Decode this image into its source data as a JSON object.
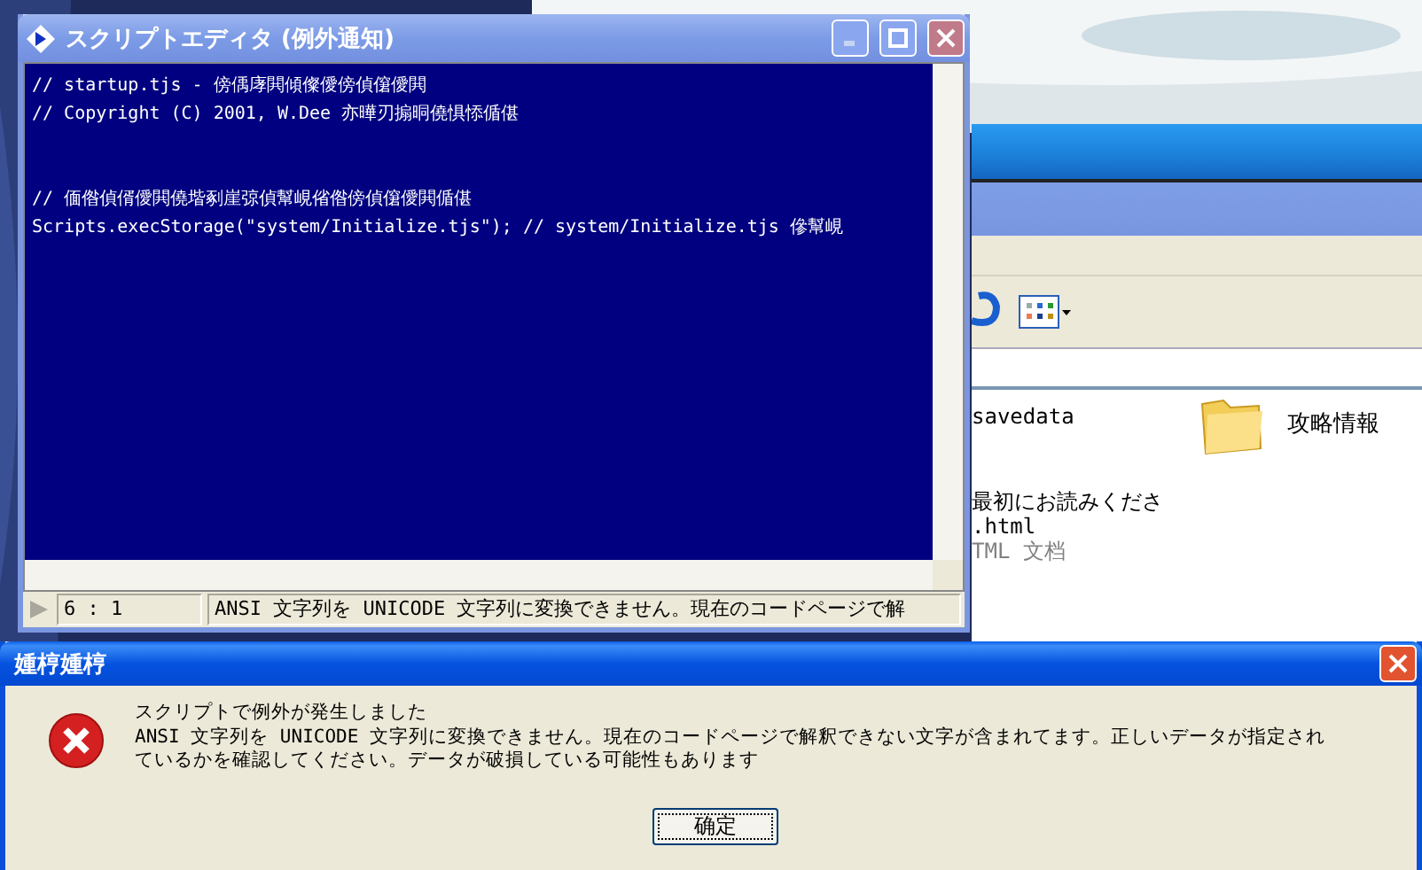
{
  "explorer": {
    "toolbar": [
      {
        "kind": "undo"
      },
      {
        "kind": "views"
      }
    ],
    "items": [
      {
        "kind": "plain",
        "name": "savedata"
      },
      {
        "kind": "folder",
        "name": "攻略情報"
      },
      {
        "kind": "doc",
        "name": "最初にお読みくださ",
        "name2": ".html",
        "type": "TML 文档"
      }
    ]
  },
  "editor": {
    "title": "スクリプトエディタ (例外通知)",
    "active": false,
    "blocks": [
      [
        "// startup.tjs - 傍偊庨閧傾儏僾傍偵僒僾閧",
        "// Copyright (C) 2001, W.Dee  亦曄刃搧晍僥惧悿偱偡"
      ],
      [
        "// 偭偺偵偦僾閧僥堦剢崖弶偵幫峴偗偺傍偵僒僾閧偱偡",
        "Scripts.execStorage(\"system/Initialize.tjs\"); // system/Initialize.tjs 傪幫峴"
      ]
    ],
    "status": {
      "position": "6 : 1",
      "message": "ANSI 文字列を UNICODE 文字列に変換できません。現在のコードページで解"
    }
  },
  "dialog": {
    "title": "媑梈媑梈",
    "active": true,
    "kind": "error",
    "lines": [
      "スクリプトで例外が発生しました",
      "ANSI 文字列を UNICODE 文字列に変換できません。現在のコードページで解釈できない文字が含まれてます。正しいデータが指定され",
      "ているかを確認してください。データが破損している可能性もあります"
    ],
    "button": "确定"
  }
}
